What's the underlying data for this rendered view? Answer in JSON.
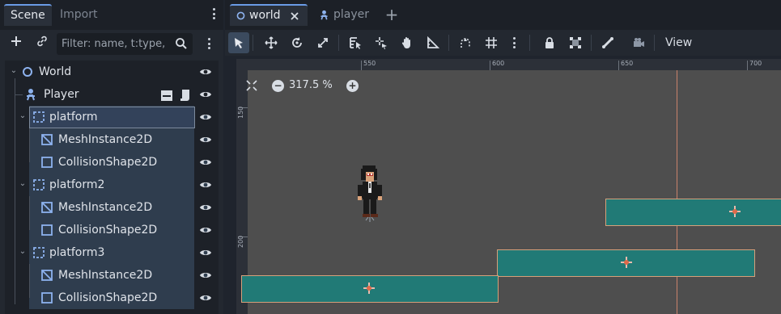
{
  "dock": {
    "tabs": {
      "scene": "Scene",
      "import": "Import"
    },
    "filter": {
      "placeholder": "Filter: name, t:type,"
    }
  },
  "tree": {
    "nodes": [
      {
        "label": "World",
        "type": "Node2D"
      },
      {
        "label": "Player",
        "type": "CharacterBody2D"
      },
      {
        "label": "platform",
        "type": "StaticBody2D"
      },
      {
        "label": "MeshInstance2D",
        "type": "MeshInstance2D"
      },
      {
        "label": "CollisionShape2D",
        "type": "CollisionShape2D"
      },
      {
        "label": "platform2",
        "type": "StaticBody2D"
      },
      {
        "label": "MeshInstance2D",
        "type": "MeshInstance2D"
      },
      {
        "label": "CollisionShape2D",
        "type": "CollisionShape2D"
      },
      {
        "label": "platform3",
        "type": "StaticBody2D"
      },
      {
        "label": "MeshInstance2D",
        "type": "MeshInstance2D"
      },
      {
        "label": "CollisionShape2D",
        "type": "CollisionShape2D"
      }
    ]
  },
  "editor": {
    "tabs": {
      "world": "world",
      "player": "player"
    },
    "view_label": "View",
    "zoom": "317.5 %"
  },
  "ruler": {
    "top_labels": [
      "550",
      "600",
      "650",
      "700"
    ],
    "left_labels": [
      "150",
      "200"
    ]
  },
  "colors": {
    "accent": "#6a9be6",
    "platform_fill": "#217a76",
    "platform_border": "#d7a07a",
    "viewport_bg": "#4e4e4e",
    "selection_bg": "#2f3d4e"
  },
  "icons": {
    "node2d": "circle-outline-icon",
    "character": "character-icon",
    "static_body": "dashed-square-icon",
    "mesh": "crossed-square-icon",
    "collision": "square-outline-icon",
    "visibility": "eye-icon"
  }
}
